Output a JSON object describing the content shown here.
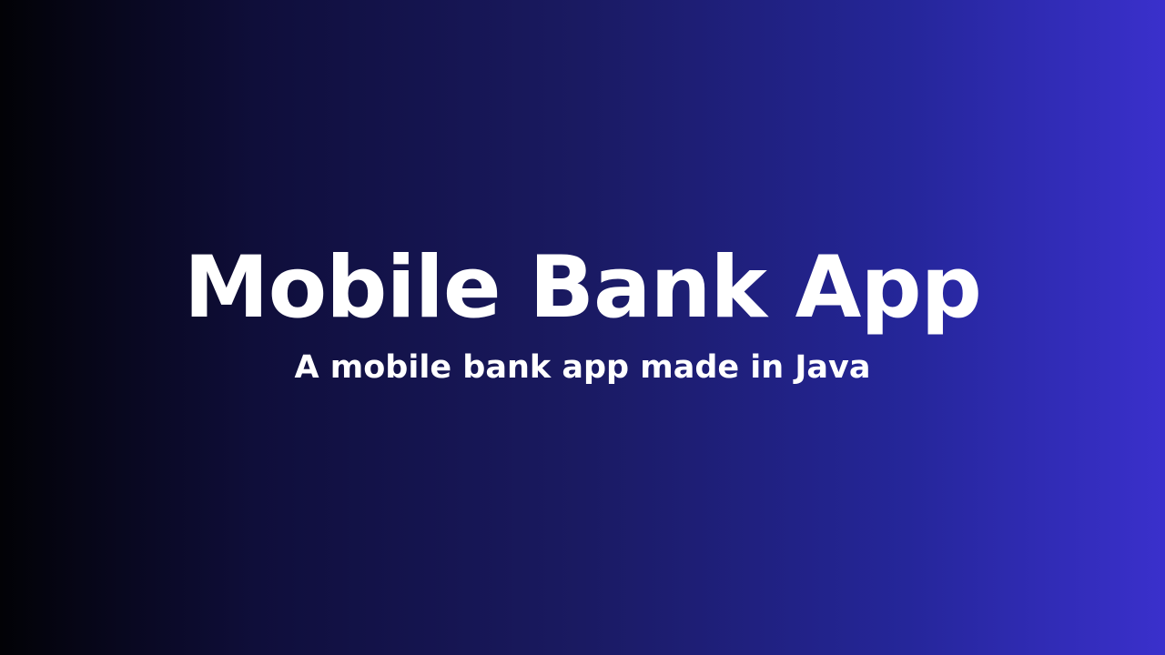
{
  "hero": {
    "title": "Mobile Bank App",
    "subtitle": "A mobile bank app made in Java"
  },
  "colors": {
    "gradient_start": "#020206",
    "gradient_end": "#3a30cc",
    "text": "#ffffff"
  }
}
